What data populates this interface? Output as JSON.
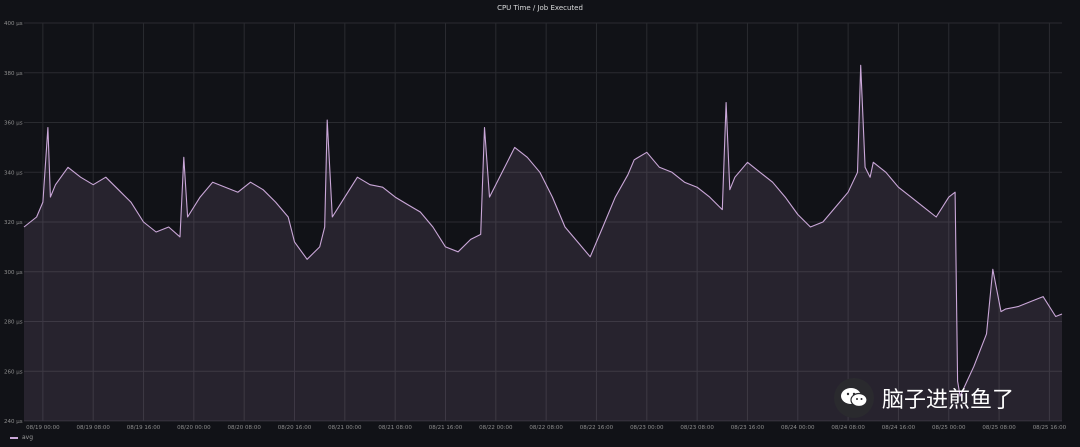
{
  "chart_data": {
    "type": "line",
    "title": "CPU Time / Job Executed",
    "xlabel": "",
    "ylabel": "",
    "y_ticks": [
      "240 µs",
      "260 µs",
      "280 µs",
      "300 µs",
      "320 µs",
      "340 µs",
      "360 µs",
      "380 µs",
      "400 µs"
    ],
    "ylim": [
      240,
      400
    ],
    "x_ticks": [
      "08/19 00:00",
      "08/19 08:00",
      "08/19 16:00",
      "08/20 00:00",
      "08/20 08:00",
      "08/20 16:00",
      "08/21 00:00",
      "08/21 08:00",
      "08/21 16:00",
      "08/22 00:00",
      "08/22 08:00",
      "08/22 16:00",
      "08/23 00:00",
      "08/23 08:00",
      "08/23 16:00",
      "08/24 00:00",
      "08/24 08:00",
      "08/24 16:00",
      "08/25 00:00",
      "08/25 08:00",
      "08/25 16:00"
    ],
    "xlim_hours": [
      -3,
      162
    ],
    "legend_position": "bottom-left",
    "grid": true,
    "series": [
      {
        "name": "avg",
        "color": "#caa7d8",
        "x": [
          -3,
          -1,
          0,
          0.8,
          1.2,
          2,
          4,
          6,
          8,
          10,
          12,
          14,
          16,
          18,
          20,
          21.8,
          22.4,
          23,
          25,
          27,
          29,
          31,
          33,
          35,
          37,
          39,
          40,
          42,
          44,
          44.8,
          45.2,
          46,
          48,
          50,
          52,
          54,
          56,
          58,
          60,
          62,
          64,
          66,
          68,
          69.6,
          70.2,
          71,
          73,
          75,
          77,
          79,
          81,
          83,
          85,
          87,
          89,
          91,
          93,
          94,
          96,
          98,
          100,
          102,
          104,
          106,
          108,
          108.6,
          109.2,
          110,
          112,
          114,
          116,
          118,
          120,
          122,
          124,
          126,
          128,
          129.5,
          130,
          130.7,
          131.5,
          132,
          134,
          136,
          138,
          140,
          142,
          144,
          145,
          145.4,
          145.8,
          148,
          150,
          151,
          152.3,
          153,
          155,
          157,
          159,
          161,
          162
        ],
        "y": [
          318,
          322,
          328,
          358,
          330,
          335,
          342,
          338,
          335,
          338,
          333,
          328,
          320,
          316,
          318,
          314,
          346,
          322,
          330,
          336,
          334,
          332,
          336,
          333,
          328,
          322,
          312,
          305,
          310,
          318,
          361,
          322,
          330,
          338,
          335,
          334,
          330,
          327,
          324,
          318,
          310,
          308,
          313,
          315,
          358,
          330,
          340,
          350,
          346,
          340,
          330,
          318,
          312,
          306,
          318,
          330,
          339,
          345,
          348,
          342,
          340,
          336,
          334,
          330,
          325,
          368,
          333,
          338,
          344,
          340,
          336,
          330,
          323,
          318,
          320,
          326,
          332,
          340,
          383,
          342,
          338,
          344,
          340,
          334,
          330,
          326,
          322,
          330,
          332,
          256,
          250,
          262,
          275,
          301,
          284,
          285,
          286,
          288,
          290,
          282,
          283
        ]
      }
    ]
  },
  "legend": {
    "label": "avg"
  },
  "watermark": {
    "text": "脑子进煎鱼了"
  }
}
